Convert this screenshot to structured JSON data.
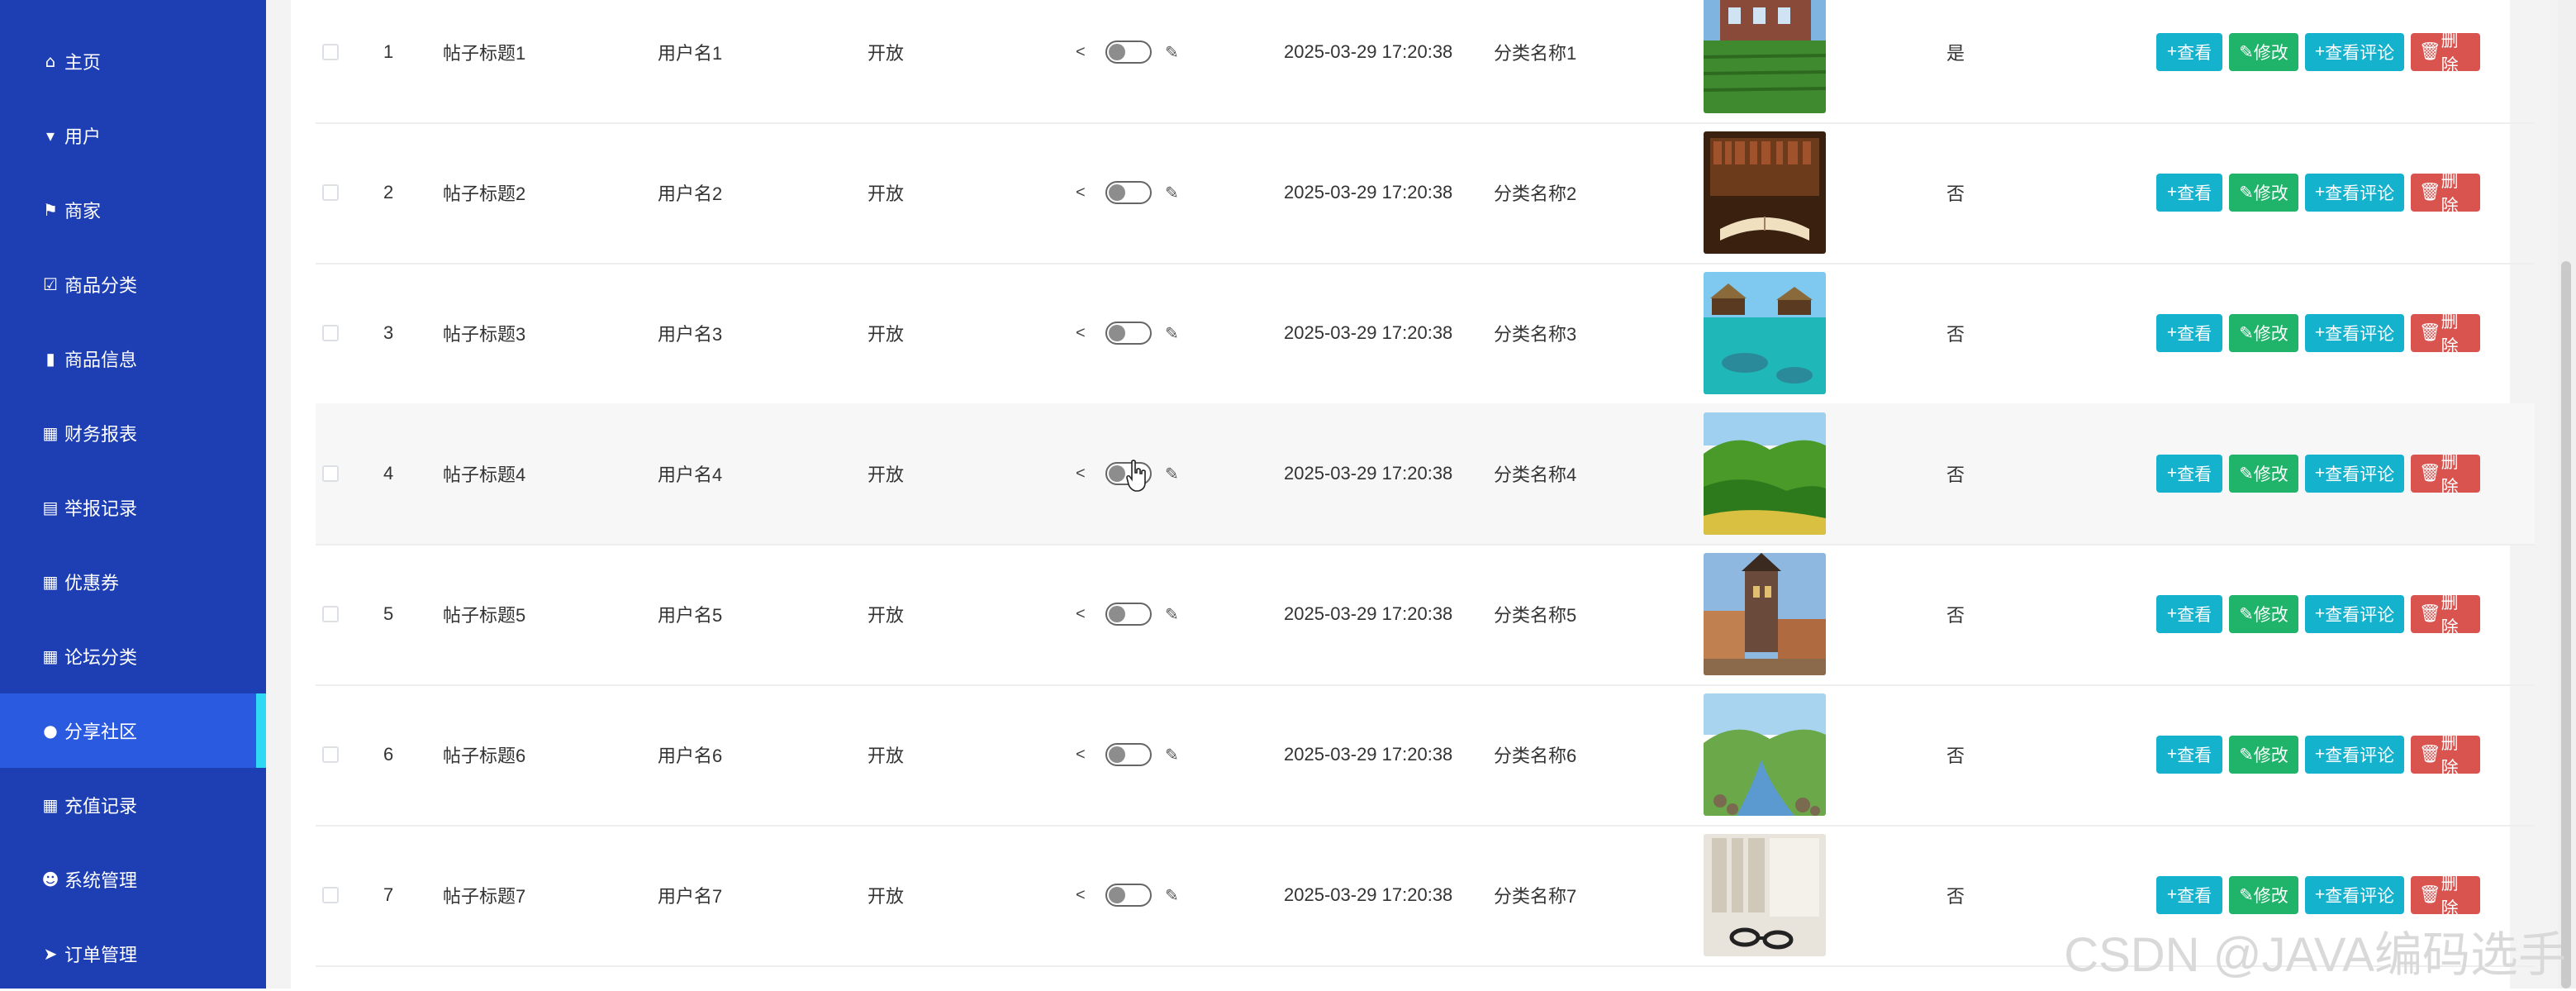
{
  "sidebar": {
    "items": [
      {
        "label": "主页",
        "icon": "home-icon",
        "glyph": "⌂"
      },
      {
        "label": "用户",
        "icon": "user-icon",
        "glyph": "▾"
      },
      {
        "label": "商家",
        "icon": "flag-icon",
        "glyph": "⚑"
      },
      {
        "label": "商品分类",
        "icon": "checkbox-icon",
        "glyph": "☑"
      },
      {
        "label": "商品信息",
        "icon": "bar-chart-icon",
        "glyph": "▮"
      },
      {
        "label": "财务报表",
        "icon": "grid-icon",
        "glyph": "▦"
      },
      {
        "label": "举报记录",
        "icon": "clipboard-icon",
        "glyph": "▤"
      },
      {
        "label": "优惠券",
        "icon": "grid-icon",
        "glyph": "▦"
      },
      {
        "label": "论坛分类",
        "icon": "grid-icon",
        "glyph": "▦"
      },
      {
        "label": "分享社区",
        "icon": "pin-icon",
        "glyph": "●",
        "active": true
      },
      {
        "label": "充值记录",
        "icon": "grid-icon",
        "glyph": "▦"
      },
      {
        "label": "系统管理",
        "icon": "person-icon",
        "glyph": "☻"
      },
      {
        "label": "订单管理",
        "icon": "send-icon",
        "glyph": "➤"
      }
    ]
  },
  "table": {
    "rows": [
      {
        "index": "1",
        "title": "帖子标题1",
        "user": "用户名1",
        "status": "开放",
        "time": "2025-03-29 17:20:38",
        "category": "分类名称1",
        "flag": "是",
        "image": "farm-field"
      },
      {
        "index": "2",
        "title": "帖子标题2",
        "user": "用户名2",
        "status": "开放",
        "time": "2025-03-29 17:20:38",
        "category": "分类名称2",
        "flag": "否",
        "image": "library-book"
      },
      {
        "index": "3",
        "title": "帖子标题3",
        "user": "用户名3",
        "status": "开放",
        "time": "2025-03-29 17:20:38",
        "category": "分类名称3",
        "flag": "否",
        "image": "tropical-water"
      },
      {
        "index": "4",
        "title": "帖子标题4",
        "user": "用户名4",
        "status": "开放",
        "time": "2025-03-29 17:20:38",
        "category": "分类名称4",
        "flag": "否",
        "image": "green-hills"
      },
      {
        "index": "5",
        "title": "帖子标题5",
        "user": "用户名5",
        "status": "开放",
        "time": "2025-03-29 17:20:38",
        "category": "分类名称5",
        "flag": "否",
        "image": "old-town-tower"
      },
      {
        "index": "6",
        "title": "帖子标题6",
        "user": "用户名6",
        "status": "开放",
        "time": "2025-03-29 17:20:38",
        "category": "分类名称6",
        "flag": "否",
        "image": "mountain-stream"
      },
      {
        "index": "7",
        "title": "帖子标题7",
        "user": "用户名7",
        "status": "开放",
        "time": "2025-03-29 17:20:38",
        "category": "分类名称7",
        "flag": "否",
        "image": "bookshelf-glasses"
      }
    ],
    "buttons": {
      "view": "查看",
      "edit": "修改",
      "comments": "查看评论",
      "delete": "删除"
    }
  },
  "watermark": "CSDN @JAVA编码选手",
  "colors": {
    "sidebar": "#1d3fb3",
    "sidebar_active": "#2a5ae0",
    "active_marker": "#2fd8f3",
    "btn_info": "#15b2ce",
    "btn_success": "#20b36a",
    "btn_danger": "#d9534f"
  }
}
